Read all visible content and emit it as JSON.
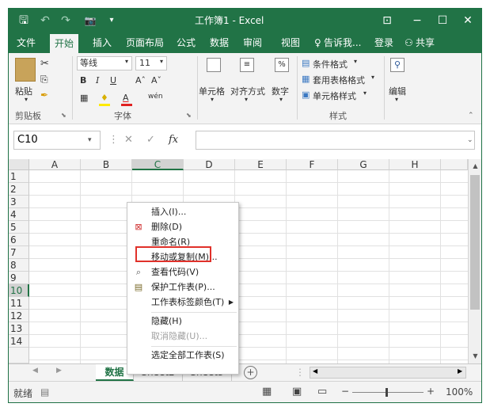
{
  "window_title": "工作簿1 - Excel",
  "qat": {
    "save": "🖫",
    "undo": "↶",
    "redo": "↷",
    "camera": "📷",
    "more": "⚲"
  },
  "win_btns": {
    "display": "⊡",
    "minimize": "−",
    "maximize": "☐",
    "close": "✕"
  },
  "menu": [
    "文件",
    "开始",
    "插入",
    "页面布局",
    "公式",
    "数据",
    "审阅",
    "视图"
  ],
  "menu_active_index": 1,
  "tellme": "告诉我...",
  "login": "登录",
  "share": "共享",
  "ribbon": {
    "paste": "粘贴",
    "clipboard_label": "剪贴板",
    "font_name": "等线",
    "font_size": "11",
    "bold": "B",
    "italic": "I",
    "underline": "U",
    "grow": "Aˆ",
    "shrink": "Aˇ",
    "wen": "wén",
    "font_label": "字体",
    "alignment": "对齐方式",
    "cell_fmt": "单元格",
    "number": "数字",
    "cond_format": "条件格式",
    "table_format": "套用表格格式",
    "cell_style": "单元格样式",
    "styles_label": "样式",
    "edit": "编辑"
  },
  "formula_bar": {
    "name_box": "C10",
    "cancel": "✕",
    "enter": "✓",
    "fx": "fx",
    "value": ""
  },
  "columns": [
    "A",
    "B",
    "C",
    "D",
    "E",
    "F",
    "G",
    "H"
  ],
  "selected_column": "C",
  "rows": [
    "1",
    "2",
    "3",
    "4",
    "5",
    "6",
    "7",
    "8",
    "9",
    "10",
    "11",
    "12",
    "13",
    "14"
  ],
  "selected_row": "10",
  "sheet_tabs": [
    "数据",
    "Sheet2",
    "Sheet3"
  ],
  "active_sheet": "数据",
  "add_sheet": "+",
  "status": {
    "ready": "就绪",
    "zoom": "100%"
  },
  "context_menu": [
    {
      "label": "插入(I)...",
      "icon": ""
    },
    {
      "label": "删除(D)",
      "icon": "delete-sheet-icon"
    },
    {
      "label": "重命名(R)",
      "icon": ""
    },
    {
      "label": "移动或复制(M)...",
      "icon": "",
      "highlighted": true
    },
    {
      "label": "查看代码(V)",
      "icon": "view-code-icon"
    },
    {
      "label": "保护工作表(P)...",
      "icon": "protect-sheet-icon"
    },
    {
      "label": "工作表标签颜色(T)",
      "icon": "",
      "submenu": true
    },
    {
      "label": "隐藏(H)",
      "icon": ""
    },
    {
      "label": "取消隐藏(U)...",
      "icon": "",
      "disabled": true
    },
    {
      "label": "选定全部工作表(S)",
      "icon": ""
    }
  ],
  "colors": {
    "accent": "#217346",
    "highlight": "#e0312a"
  }
}
